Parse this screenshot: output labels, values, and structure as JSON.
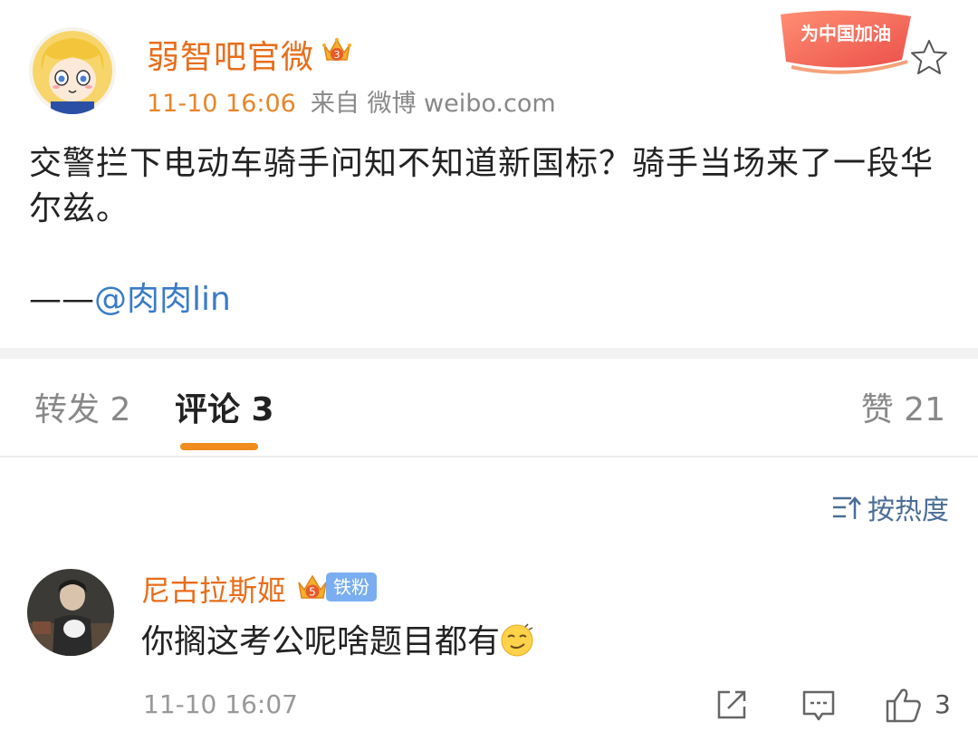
{
  "post": {
    "author": "弱智吧官微",
    "time": "11-10 16:06",
    "source": "来自 微博 weibo.com",
    "campaign_badge": "为中国加油",
    "text": "交警拦下电动车骑手问知不知道新国标？骑手当场来了一段华尔兹。",
    "signature_prefix": "——",
    "signature_mention": "@肉肉lin",
    "crown_level": "3"
  },
  "tabs": {
    "repost": "转发 2",
    "comments": "评论 3",
    "likes": "赞 21"
  },
  "sort": {
    "label": "按热度"
  },
  "comment": {
    "author": "尼古拉斯姬",
    "crown_level": "5",
    "fan_badge": "铁粉",
    "text": "你搁这考公呢啥题目都有",
    "emoji": "smirk-emoji",
    "time": "11-10 16:07",
    "like_count": "3"
  },
  "colors": {
    "accent_orange": "#e86d1a",
    "tab_indicator": "#f08c1c",
    "link_blue": "#3a7bc8",
    "fan_badge_blue": "#7aaef0"
  }
}
